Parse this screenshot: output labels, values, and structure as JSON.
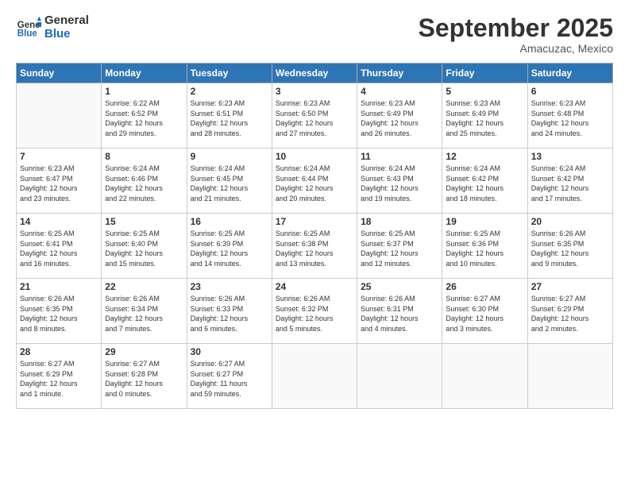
{
  "logo": {
    "general": "General",
    "blue": "Blue"
  },
  "title": "September 2025",
  "subtitle": "Amacuzac, Mexico",
  "days_of_week": [
    "Sunday",
    "Monday",
    "Tuesday",
    "Wednesday",
    "Thursday",
    "Friday",
    "Saturday"
  ],
  "weeks": [
    [
      {
        "day": "",
        "info": ""
      },
      {
        "day": "1",
        "info": "Sunrise: 6:22 AM\nSunset: 6:52 PM\nDaylight: 12 hours\nand 29 minutes."
      },
      {
        "day": "2",
        "info": "Sunrise: 6:23 AM\nSunset: 6:51 PM\nDaylight: 12 hours\nand 28 minutes."
      },
      {
        "day": "3",
        "info": "Sunrise: 6:23 AM\nSunset: 6:50 PM\nDaylight: 12 hours\nand 27 minutes."
      },
      {
        "day": "4",
        "info": "Sunrise: 6:23 AM\nSunset: 6:49 PM\nDaylight: 12 hours\nand 26 minutes."
      },
      {
        "day": "5",
        "info": "Sunrise: 6:23 AM\nSunset: 6:49 PM\nDaylight: 12 hours\nand 25 minutes."
      },
      {
        "day": "6",
        "info": "Sunrise: 6:23 AM\nSunset: 6:48 PM\nDaylight: 12 hours\nand 24 minutes."
      }
    ],
    [
      {
        "day": "7",
        "info": "Sunrise: 6:23 AM\nSunset: 6:47 PM\nDaylight: 12 hours\nand 23 minutes."
      },
      {
        "day": "8",
        "info": "Sunrise: 6:24 AM\nSunset: 6:46 PM\nDaylight: 12 hours\nand 22 minutes."
      },
      {
        "day": "9",
        "info": "Sunrise: 6:24 AM\nSunset: 6:45 PM\nDaylight: 12 hours\nand 21 minutes."
      },
      {
        "day": "10",
        "info": "Sunrise: 6:24 AM\nSunset: 6:44 PM\nDaylight: 12 hours\nand 20 minutes."
      },
      {
        "day": "11",
        "info": "Sunrise: 6:24 AM\nSunset: 6:43 PM\nDaylight: 12 hours\nand 19 minutes."
      },
      {
        "day": "12",
        "info": "Sunrise: 6:24 AM\nSunset: 6:42 PM\nDaylight: 12 hours\nand 18 minutes."
      },
      {
        "day": "13",
        "info": "Sunrise: 6:24 AM\nSunset: 6:42 PM\nDaylight: 12 hours\nand 17 minutes."
      }
    ],
    [
      {
        "day": "14",
        "info": "Sunrise: 6:25 AM\nSunset: 6:41 PM\nDaylight: 12 hours\nand 16 minutes."
      },
      {
        "day": "15",
        "info": "Sunrise: 6:25 AM\nSunset: 6:40 PM\nDaylight: 12 hours\nand 15 minutes."
      },
      {
        "day": "16",
        "info": "Sunrise: 6:25 AM\nSunset: 6:39 PM\nDaylight: 12 hours\nand 14 minutes."
      },
      {
        "day": "17",
        "info": "Sunrise: 6:25 AM\nSunset: 6:38 PM\nDaylight: 12 hours\nand 13 minutes."
      },
      {
        "day": "18",
        "info": "Sunrise: 6:25 AM\nSunset: 6:37 PM\nDaylight: 12 hours\nand 12 minutes."
      },
      {
        "day": "19",
        "info": "Sunrise: 6:25 AM\nSunset: 6:36 PM\nDaylight: 12 hours\nand 10 minutes."
      },
      {
        "day": "20",
        "info": "Sunrise: 6:26 AM\nSunset: 6:35 PM\nDaylight: 12 hours\nand 9 minutes."
      }
    ],
    [
      {
        "day": "21",
        "info": "Sunrise: 6:26 AM\nSunset: 6:35 PM\nDaylight: 12 hours\nand 8 minutes."
      },
      {
        "day": "22",
        "info": "Sunrise: 6:26 AM\nSunset: 6:34 PM\nDaylight: 12 hours\nand 7 minutes."
      },
      {
        "day": "23",
        "info": "Sunrise: 6:26 AM\nSunset: 6:33 PM\nDaylight: 12 hours\nand 6 minutes."
      },
      {
        "day": "24",
        "info": "Sunrise: 6:26 AM\nSunset: 6:32 PM\nDaylight: 12 hours\nand 5 minutes."
      },
      {
        "day": "25",
        "info": "Sunrise: 6:26 AM\nSunset: 6:31 PM\nDaylight: 12 hours\nand 4 minutes."
      },
      {
        "day": "26",
        "info": "Sunrise: 6:27 AM\nSunset: 6:30 PM\nDaylight: 12 hours\nand 3 minutes."
      },
      {
        "day": "27",
        "info": "Sunrise: 6:27 AM\nSunset: 6:29 PM\nDaylight: 12 hours\nand 2 minutes."
      }
    ],
    [
      {
        "day": "28",
        "info": "Sunrise: 6:27 AM\nSunset: 6:29 PM\nDaylight: 12 hours\nand 1 minute."
      },
      {
        "day": "29",
        "info": "Sunrise: 6:27 AM\nSunset: 6:28 PM\nDaylight: 12 hours\nand 0 minutes."
      },
      {
        "day": "30",
        "info": "Sunrise: 6:27 AM\nSunset: 6:27 PM\nDaylight: 11 hours\nand 59 minutes."
      },
      {
        "day": "",
        "info": ""
      },
      {
        "day": "",
        "info": ""
      },
      {
        "day": "",
        "info": ""
      },
      {
        "day": "",
        "info": ""
      }
    ]
  ]
}
